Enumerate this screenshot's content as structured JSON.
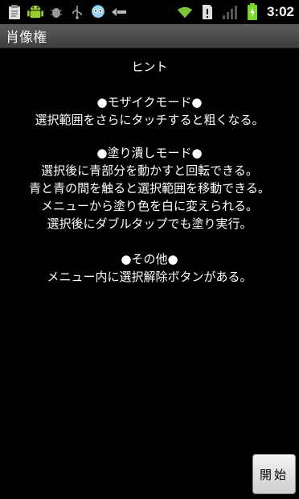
{
  "status_bar": {
    "time": "3:02",
    "left_icons": [
      "clipboard-icon",
      "android-icon",
      "debug-icon",
      "usb-icon",
      "chat-bubble-icon",
      "signal-arrow-icon"
    ],
    "right_icons": [
      "wifi-icon",
      "sim-alert-icon",
      "cell-signal-icon",
      "battery-charging-icon"
    ]
  },
  "title_bar": {
    "title": "肖像権"
  },
  "hint": {
    "heading": "ヒント",
    "mosaic": {
      "title": "●モザイクモード●",
      "lines": [
        "選択範囲をさらにタッチすると粗くなる。"
      ]
    },
    "paint": {
      "title": "●塗り潰しモード●",
      "lines": [
        "選択後に青部分を動かすと回転できる。",
        "青と青の間を触ると選択範囲を移動できる。",
        "メニューから塗り色を白に変えられる。",
        "選択後にダブルタップでも塗り実行。"
      ]
    },
    "other": {
      "title": "●その他●",
      "lines": [
        "メニュー内に選択解除ボタンがある。"
      ]
    }
  },
  "buttons": {
    "start": "開始"
  },
  "colors": {
    "background": "#000000",
    "text": "#ffffff",
    "battery": "#7bd332"
  }
}
